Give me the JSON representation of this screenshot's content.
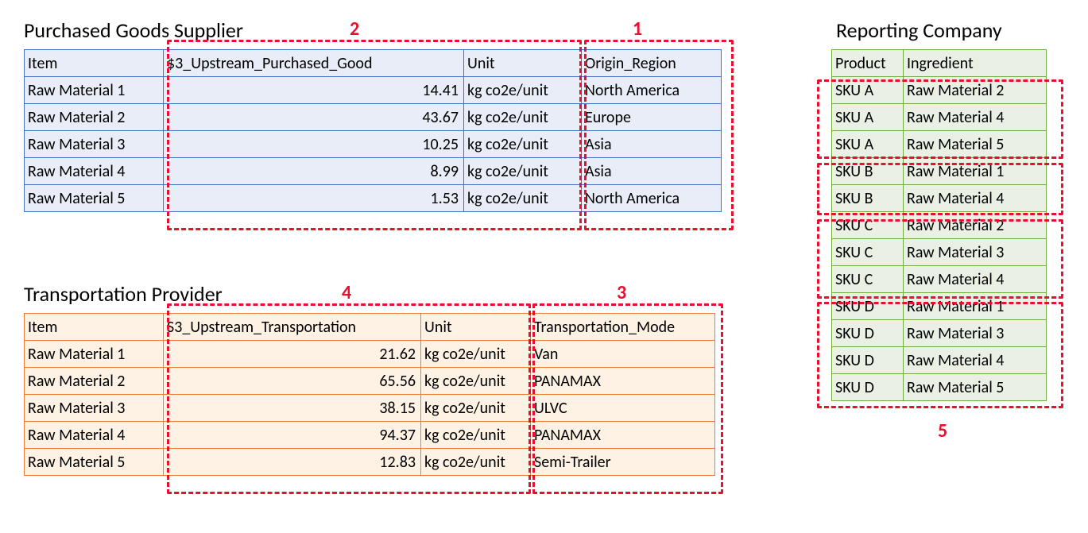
{
  "sections": {
    "supplier_title": "Purchased Goods Supplier",
    "transport_title": "Transportation Provider",
    "reporting_title": "Reporting Company"
  },
  "supplier": {
    "headers": {
      "item": "Item",
      "value": "$3_Upstream_Purchased_Good",
      "unit": "Unit",
      "region": "Origin_Region"
    },
    "rows": [
      {
        "item": "Raw Material 1",
        "value": "14.41",
        "unit": "kg co2e/unit",
        "region": "North America"
      },
      {
        "item": "Raw Material 2",
        "value": "43.67",
        "unit": "kg co2e/unit",
        "region": "Europe"
      },
      {
        "item": "Raw Material 3",
        "value": "10.25",
        "unit": "kg co2e/unit",
        "region": "Asia"
      },
      {
        "item": "Raw Material 4",
        "value": "8.99",
        "unit": "kg co2e/unit",
        "region": "Asia"
      },
      {
        "item": "Raw Material 5",
        "value": "1.53",
        "unit": "kg co2e/unit",
        "region": "North America"
      }
    ]
  },
  "transport": {
    "headers": {
      "item": "Item",
      "value": "S3_Upstream_Transportation",
      "unit": "Unit",
      "mode": "Transportation_Mode"
    },
    "rows": [
      {
        "item": "Raw Material 1",
        "value": "21.62",
        "unit": "kg co2e/unit",
        "mode": "Van"
      },
      {
        "item": "Raw Material 2",
        "value": "65.56",
        "unit": "kg co2e/unit",
        "mode": "PANAMAX"
      },
      {
        "item": "Raw Material 3",
        "value": "38.15",
        "unit": "kg co2e/unit",
        "mode": "ULVC"
      },
      {
        "item": "Raw Material 4",
        "value": "94.37",
        "unit": "kg co2e/unit",
        "mode": "PANAMAX"
      },
      {
        "item": "Raw Material 5",
        "value": "12.83",
        "unit": "kg co2e/unit",
        "mode": "Semi-Trailer"
      }
    ]
  },
  "reporting": {
    "headers": {
      "product": "Product",
      "ingredient": "Ingredient"
    },
    "rows": [
      {
        "product": "SKU A",
        "ingredient": "Raw Material 2"
      },
      {
        "product": "SKU A",
        "ingredient": "Raw Material 4"
      },
      {
        "product": "SKU A",
        "ingredient": "Raw Material 5"
      },
      {
        "product": "SKU B",
        "ingredient": "Raw Material 1"
      },
      {
        "product": "SKU B",
        "ingredient": "Raw Material 4"
      },
      {
        "product": "SKU C",
        "ingredient": "Raw Material 2"
      },
      {
        "product": "SKU C",
        "ingredient": "Raw Material 3"
      },
      {
        "product": "SKU C",
        "ingredient": "Raw Material 4"
      },
      {
        "product": "SKU D",
        "ingredient": "Raw Material 1"
      },
      {
        "product": "SKU D",
        "ingredient": "Raw Material 3"
      },
      {
        "product": "SKU D",
        "ingredient": "Raw Material 4"
      },
      {
        "product": "SKU D",
        "ingredient": "Raw Material 5"
      }
    ]
  },
  "annotations": {
    "n1": "1",
    "n2": "2",
    "n3": "3",
    "n4": "4",
    "n5": "5"
  }
}
